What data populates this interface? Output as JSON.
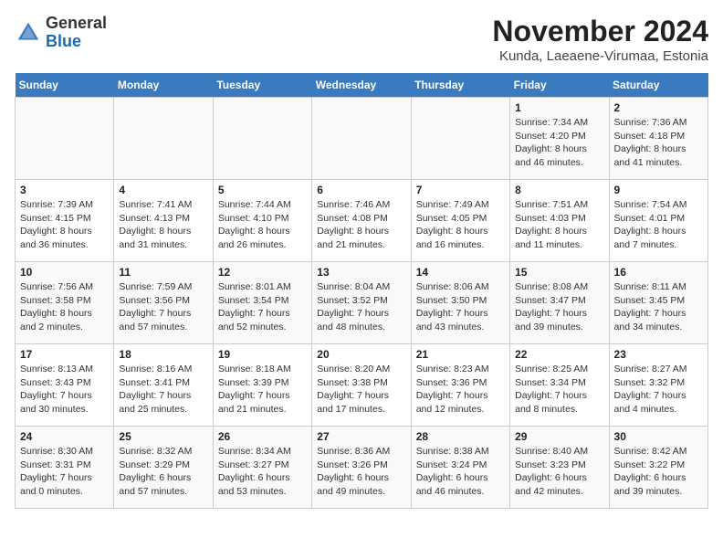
{
  "logo": {
    "general": "General",
    "blue": "Blue"
  },
  "title": "November 2024",
  "subtitle": "Kunda, Laeaene-Virumaa, Estonia",
  "weekdays": [
    "Sunday",
    "Monday",
    "Tuesday",
    "Wednesday",
    "Thursday",
    "Friday",
    "Saturday"
  ],
  "weeks": [
    [
      {
        "day": "",
        "sunrise": "",
        "sunset": "",
        "daylight": ""
      },
      {
        "day": "",
        "sunrise": "",
        "sunset": "",
        "daylight": ""
      },
      {
        "day": "",
        "sunrise": "",
        "sunset": "",
        "daylight": ""
      },
      {
        "day": "",
        "sunrise": "",
        "sunset": "",
        "daylight": ""
      },
      {
        "day": "",
        "sunrise": "",
        "sunset": "",
        "daylight": ""
      },
      {
        "day": "1",
        "sunrise": "Sunrise: 7:34 AM",
        "sunset": "Sunset: 4:20 PM",
        "daylight": "Daylight: 8 hours and 46 minutes."
      },
      {
        "day": "2",
        "sunrise": "Sunrise: 7:36 AM",
        "sunset": "Sunset: 4:18 PM",
        "daylight": "Daylight: 8 hours and 41 minutes."
      }
    ],
    [
      {
        "day": "3",
        "sunrise": "Sunrise: 7:39 AM",
        "sunset": "Sunset: 4:15 PM",
        "daylight": "Daylight: 8 hours and 36 minutes."
      },
      {
        "day": "4",
        "sunrise": "Sunrise: 7:41 AM",
        "sunset": "Sunset: 4:13 PM",
        "daylight": "Daylight: 8 hours and 31 minutes."
      },
      {
        "day": "5",
        "sunrise": "Sunrise: 7:44 AM",
        "sunset": "Sunset: 4:10 PM",
        "daylight": "Daylight: 8 hours and 26 minutes."
      },
      {
        "day": "6",
        "sunrise": "Sunrise: 7:46 AM",
        "sunset": "Sunset: 4:08 PM",
        "daylight": "Daylight: 8 hours and 21 minutes."
      },
      {
        "day": "7",
        "sunrise": "Sunrise: 7:49 AM",
        "sunset": "Sunset: 4:05 PM",
        "daylight": "Daylight: 8 hours and 16 minutes."
      },
      {
        "day": "8",
        "sunrise": "Sunrise: 7:51 AM",
        "sunset": "Sunset: 4:03 PM",
        "daylight": "Daylight: 8 hours and 11 minutes."
      },
      {
        "day": "9",
        "sunrise": "Sunrise: 7:54 AM",
        "sunset": "Sunset: 4:01 PM",
        "daylight": "Daylight: 8 hours and 7 minutes."
      }
    ],
    [
      {
        "day": "10",
        "sunrise": "Sunrise: 7:56 AM",
        "sunset": "Sunset: 3:58 PM",
        "daylight": "Daylight: 8 hours and 2 minutes."
      },
      {
        "day": "11",
        "sunrise": "Sunrise: 7:59 AM",
        "sunset": "Sunset: 3:56 PM",
        "daylight": "Daylight: 7 hours and 57 minutes."
      },
      {
        "day": "12",
        "sunrise": "Sunrise: 8:01 AM",
        "sunset": "Sunset: 3:54 PM",
        "daylight": "Daylight: 7 hours and 52 minutes."
      },
      {
        "day": "13",
        "sunrise": "Sunrise: 8:04 AM",
        "sunset": "Sunset: 3:52 PM",
        "daylight": "Daylight: 7 hours and 48 minutes."
      },
      {
        "day": "14",
        "sunrise": "Sunrise: 8:06 AM",
        "sunset": "Sunset: 3:50 PM",
        "daylight": "Daylight: 7 hours and 43 minutes."
      },
      {
        "day": "15",
        "sunrise": "Sunrise: 8:08 AM",
        "sunset": "Sunset: 3:47 PM",
        "daylight": "Daylight: 7 hours and 39 minutes."
      },
      {
        "day": "16",
        "sunrise": "Sunrise: 8:11 AM",
        "sunset": "Sunset: 3:45 PM",
        "daylight": "Daylight: 7 hours and 34 minutes."
      }
    ],
    [
      {
        "day": "17",
        "sunrise": "Sunrise: 8:13 AM",
        "sunset": "Sunset: 3:43 PM",
        "daylight": "Daylight: 7 hours and 30 minutes."
      },
      {
        "day": "18",
        "sunrise": "Sunrise: 8:16 AM",
        "sunset": "Sunset: 3:41 PM",
        "daylight": "Daylight: 7 hours and 25 minutes."
      },
      {
        "day": "19",
        "sunrise": "Sunrise: 8:18 AM",
        "sunset": "Sunset: 3:39 PM",
        "daylight": "Daylight: 7 hours and 21 minutes."
      },
      {
        "day": "20",
        "sunrise": "Sunrise: 8:20 AM",
        "sunset": "Sunset: 3:38 PM",
        "daylight": "Daylight: 7 hours and 17 minutes."
      },
      {
        "day": "21",
        "sunrise": "Sunrise: 8:23 AM",
        "sunset": "Sunset: 3:36 PM",
        "daylight": "Daylight: 7 hours and 12 minutes."
      },
      {
        "day": "22",
        "sunrise": "Sunrise: 8:25 AM",
        "sunset": "Sunset: 3:34 PM",
        "daylight": "Daylight: 7 hours and 8 minutes."
      },
      {
        "day": "23",
        "sunrise": "Sunrise: 8:27 AM",
        "sunset": "Sunset: 3:32 PM",
        "daylight": "Daylight: 7 hours and 4 minutes."
      }
    ],
    [
      {
        "day": "24",
        "sunrise": "Sunrise: 8:30 AM",
        "sunset": "Sunset: 3:31 PM",
        "daylight": "Daylight: 7 hours and 0 minutes."
      },
      {
        "day": "25",
        "sunrise": "Sunrise: 8:32 AM",
        "sunset": "Sunset: 3:29 PM",
        "daylight": "Daylight: 6 hours and 57 minutes."
      },
      {
        "day": "26",
        "sunrise": "Sunrise: 8:34 AM",
        "sunset": "Sunset: 3:27 PM",
        "daylight": "Daylight: 6 hours and 53 minutes."
      },
      {
        "day": "27",
        "sunrise": "Sunrise: 8:36 AM",
        "sunset": "Sunset: 3:26 PM",
        "daylight": "Daylight: 6 hours and 49 minutes."
      },
      {
        "day": "28",
        "sunrise": "Sunrise: 8:38 AM",
        "sunset": "Sunset: 3:24 PM",
        "daylight": "Daylight: 6 hours and 46 minutes."
      },
      {
        "day": "29",
        "sunrise": "Sunrise: 8:40 AM",
        "sunset": "Sunset: 3:23 PM",
        "daylight": "Daylight: 6 hours and 42 minutes."
      },
      {
        "day": "30",
        "sunrise": "Sunrise: 8:42 AM",
        "sunset": "Sunset: 3:22 PM",
        "daylight": "Daylight: 6 hours and 39 minutes."
      }
    ]
  ]
}
